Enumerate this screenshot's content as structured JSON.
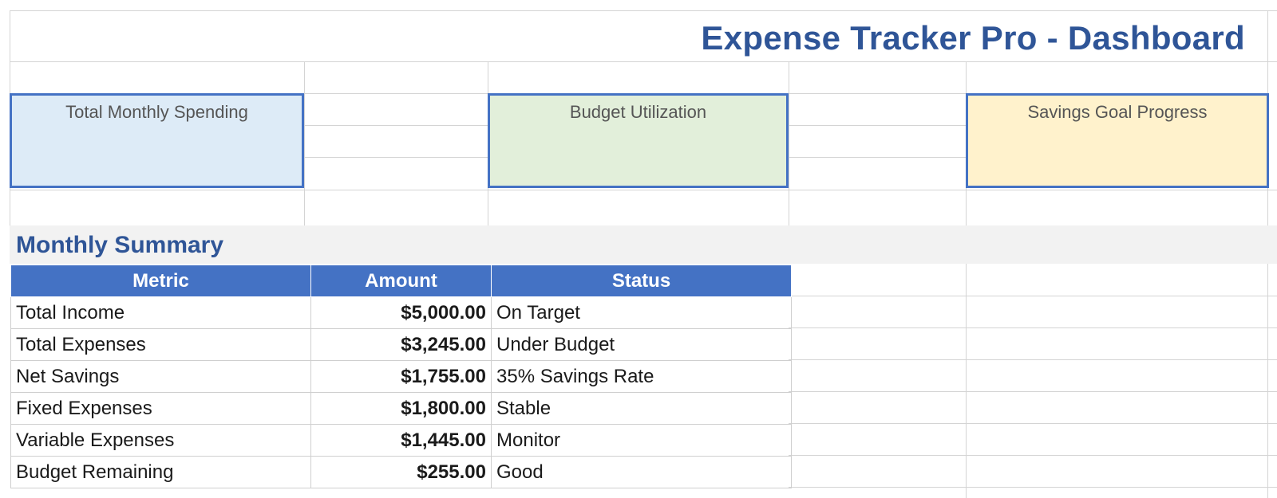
{
  "app": {
    "title": "Expense Tracker Pro - Dashboard"
  },
  "cards": [
    {
      "label": "Total Monthly Spending",
      "color": "#ddebf7"
    },
    {
      "label": "Budget Utilization",
      "color": "#e2efda"
    },
    {
      "label": "Savings Goal Progress",
      "color": "#fff2cc"
    }
  ],
  "summary": {
    "title": "Monthly Summary",
    "columns": [
      "Metric",
      "Amount",
      "Status"
    ],
    "rows": [
      {
        "metric": "Total Income",
        "amount": "$5,000.00",
        "status": "On Target"
      },
      {
        "metric": "Total Expenses",
        "amount": "$3,245.00",
        "status": "Under Budget"
      },
      {
        "metric": "Net Savings",
        "amount": "$1,755.00",
        "status": "35% Savings Rate"
      },
      {
        "metric": "Fixed Expenses",
        "amount": "$1,800.00",
        "status": "Stable"
      },
      {
        "metric": "Variable Expenses",
        "amount": "$1,445.00",
        "status": "Monitor"
      },
      {
        "metric": "Budget Remaining",
        "amount": "$255.00",
        "status": "Good"
      }
    ]
  },
  "colors": {
    "header_bg": "#4472c4",
    "title": "#2f5597",
    "card_border": "#4472c4"
  }
}
